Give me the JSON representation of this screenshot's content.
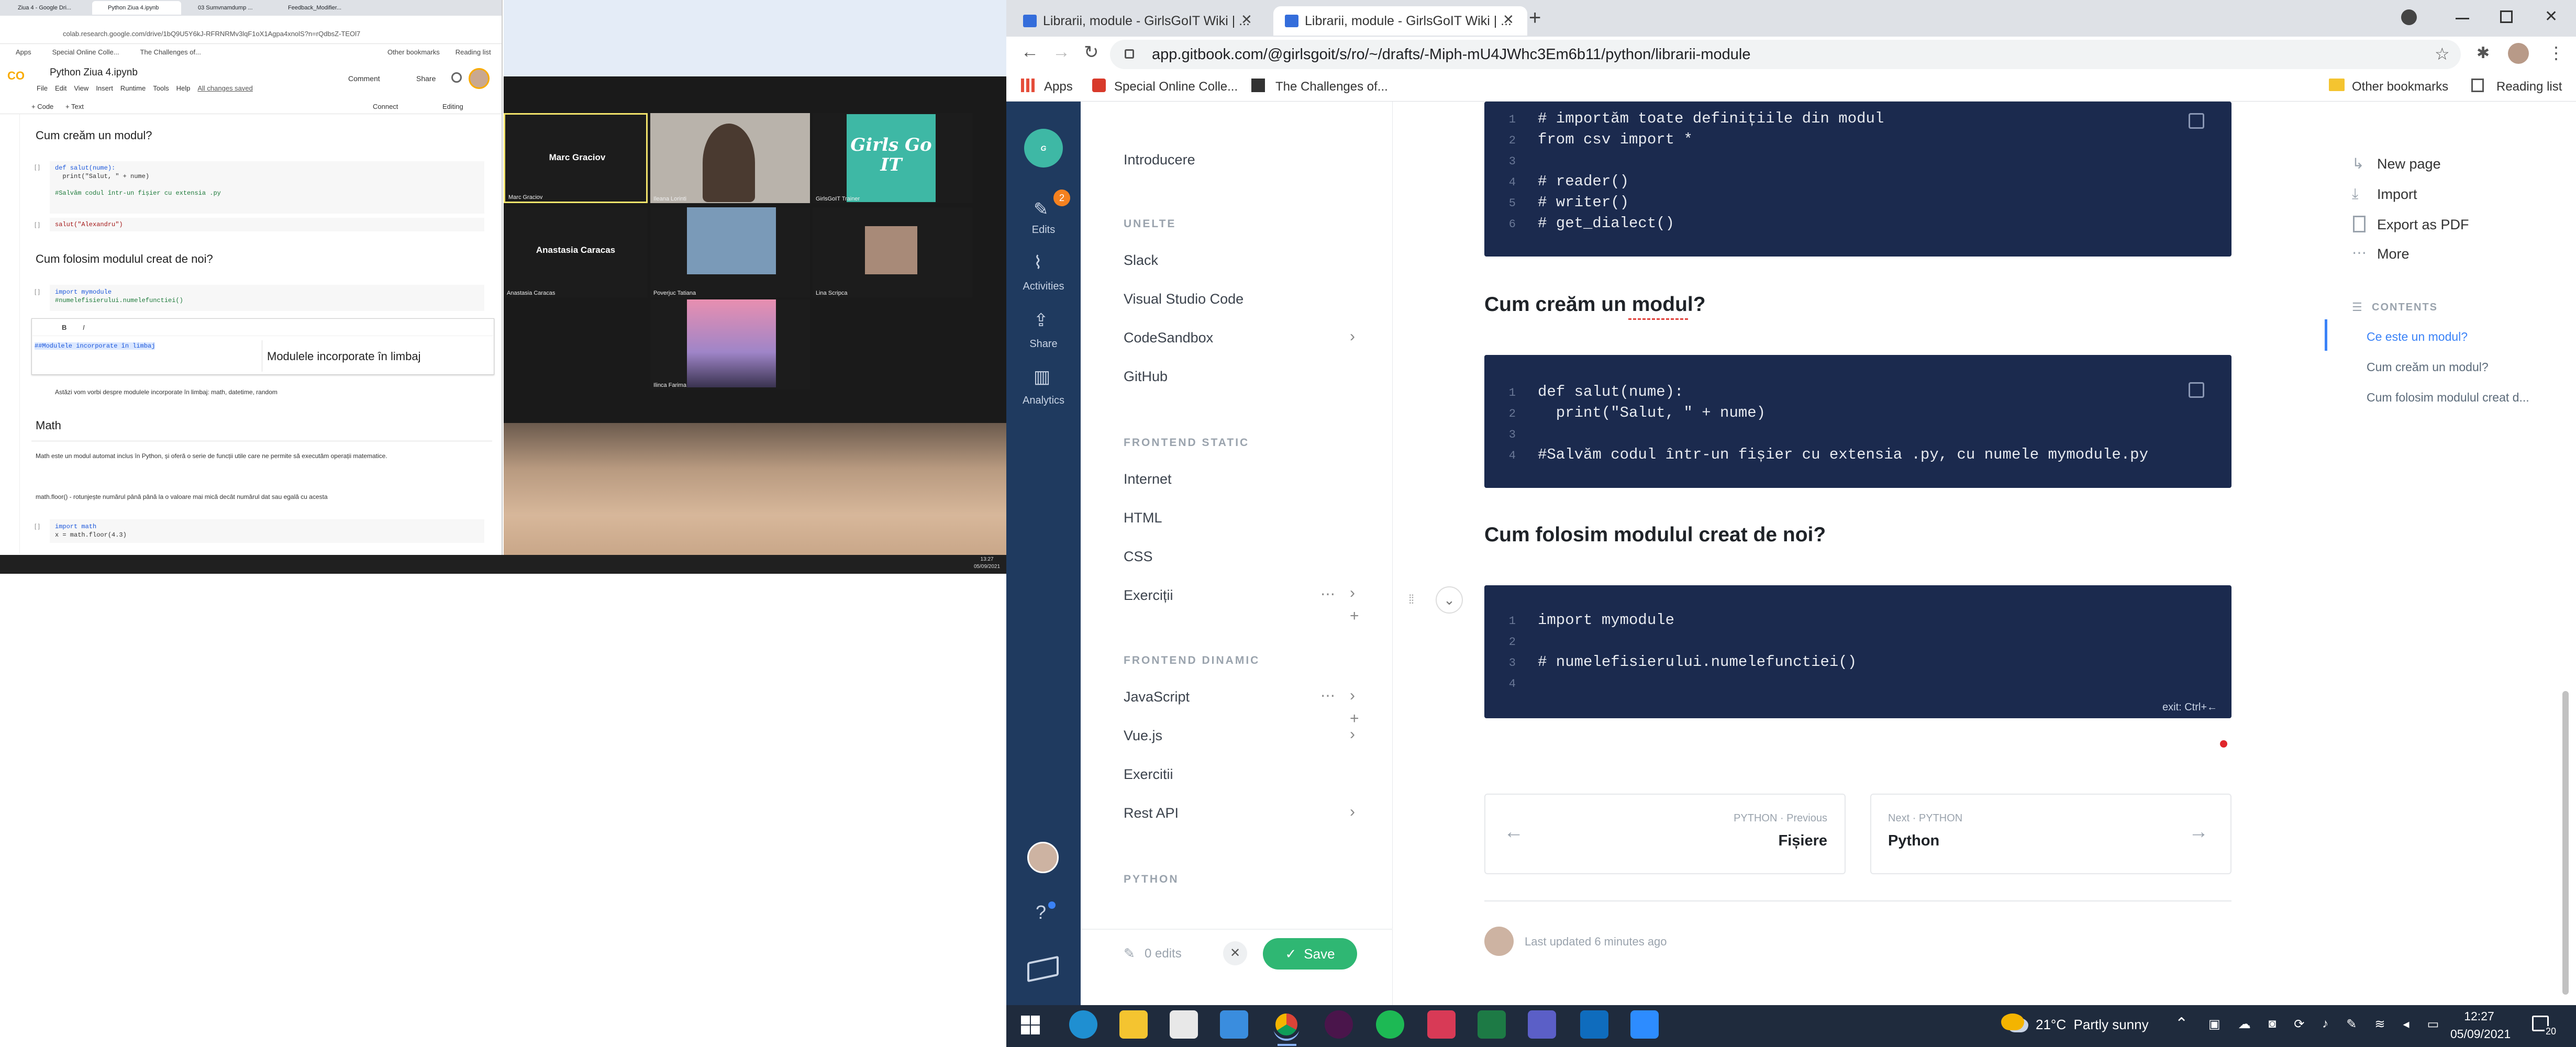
{
  "colab": {
    "tabs": [
      "Ziua 4 - Google Dri...",
      "Python Ziua 4.ipynb",
      "03 Sumvnamdump ...",
      "Feedback_Modifier..."
    ],
    "url": "colab.research.google.com/drive/1bQ9U5Y6kJ-RFRNRMv3lqF1oX1Agpa4xnolS?n=rQdbsZ-TEOl7",
    "bookmarks": [
      "Apps",
      "Special Online Colle...",
      "The Challenges of..."
    ],
    "bookmarks_right": [
      "Other bookmarks",
      "Reading list"
    ],
    "title": "Python Ziua 4.ipynb",
    "menu": [
      "File",
      "Edit",
      "View",
      "Insert",
      "Runtime",
      "Tools",
      "Help"
    ],
    "saved": "All changes saved",
    "comment": "Comment",
    "share": "Share",
    "add_code": "+ Code",
    "add_text": "+ Text",
    "connect": "Connect",
    "editing": "Editing",
    "h_create": "Cum creăm un modul?",
    "code1": [
      "def salut(nume):",
      "  print(\"Salut, \" + nume)",
      "",
      "#Salvăm codul într-un fișier cu extensia .py"
    ],
    "code2": "salut(\"Alexandru\")",
    "h_use": "Cum folosim modulul creat de noi?",
    "code3": [
      "import mymodule",
      "#numelefisierului.numelefunctiei()"
    ],
    "md_src": "##Modulele incorporate în limbaj",
    "md_preview": "Modulele incorporate în limbaj",
    "bullet": "Astăzi vom vorbi despre modulele incorporate în limbaj: math, datetime, random",
    "h_math": "Math",
    "math_text": "Math este un modul automat inclus în Python, și oferă o serie de funcții utile care ne permite să executăm operații matematice.",
    "floor_text": "math.floor() - rotunjește numărul până până la o valoare mai mică decât numărul dat sau egală cu acesta",
    "code4": [
      "import math",
      "x = math.floor(4.3)"
    ]
  },
  "zoom": {
    "tiles": [
      {
        "name": "Marc Graciov",
        "label": "Marc Graciov"
      },
      {
        "name": "",
        "label": "Ileana Lorinti"
      },
      {
        "name": "",
        "label": "GirlsGoIT Trainer",
        "logo": "Girls Go IT"
      },
      {
        "name": "Anastasia Caracas",
        "label": "Anastasia Caracas"
      },
      {
        "name": "",
        "label": "Poverjuc Tatiana"
      },
      {
        "name": "",
        "label": "Lina Scripca"
      },
      {
        "name": "",
        "label": "Ilinca Farima"
      }
    ]
  },
  "taskbar_left": {
    "time": "13:27",
    "date": "05/09/2021"
  },
  "browser": {
    "tabs": [
      {
        "label": "Librarii, module - GirlsGoIT Wiki | ..."
      },
      {
        "label": "Librarii, module - GirlsGoIT Wiki | ..."
      }
    ],
    "url": "app.gitbook.com/@girlsgoit/s/ro/~/drafts/-Miph-mU4JWhc3Em6b11/python/librarii-module",
    "bookmarks": [
      "Apps",
      "Special Online Colle...",
      "The Challenges of..."
    ],
    "other_bookmarks": "Other bookmarks",
    "reading_list": "Reading list"
  },
  "gitbook": {
    "rail": [
      {
        "label": "Edits",
        "badge": "2"
      },
      {
        "label": "Activities"
      },
      {
        "label": "Share"
      },
      {
        "label": "Analytics"
      }
    ],
    "nav_intro": "Introducere",
    "sections": [
      {
        "title": "UNELTE",
        "items": [
          "Slack",
          "Visual Studio Code",
          "CodeSandbox",
          "GitHub"
        ]
      },
      {
        "title": "FRONTEND STATIC",
        "items": [
          "Internet",
          "HTML",
          "CSS",
          "Exerciții"
        ]
      },
      {
        "title": "FRONTEND DINAMIC",
        "items": [
          "JavaScript",
          "Vue.js",
          "Exercitii",
          "Rest API"
        ]
      },
      {
        "title": "PYTHON",
        "items": []
      }
    ],
    "edits_count": "0 edits",
    "save": "Save",
    "code_top": [
      "# importăm toate definițiile din modul",
      "from csv import *",
      "",
      "# reader()",
      "# writer()",
      "# get_dialect()"
    ],
    "h_create": "Cum creăm un modul?",
    "code_mid": [
      "def salut(nume):",
      "  print(\"Salut, \" + nume)",
      "",
      "#Salvăm codul într-un fișier cu extensia .py, cu numele mymodule.py"
    ],
    "h_use": "Cum folosim modulul creat de noi?",
    "code_bot": [
      "import mymodule",
      "",
      "# numelefisierului.numelefunctiei()",
      ""
    ],
    "exit_hint": "exit: Ctrl+←",
    "prev_label": "PYTHON · Previous",
    "prev_title": "Fișiere",
    "next_label": "Next · PYTHON",
    "next_title": "Python",
    "last_updated": "Last updated 6 minutes ago",
    "actions": [
      "New page",
      "Import",
      "Export as PDF",
      "More"
    ],
    "contents_title": "CONTENTS",
    "toc": [
      "Ce este un modul?",
      "Cum creăm un modul?",
      "Cum folosim modulul creat d..."
    ]
  },
  "taskbar": {
    "weather": "21°C  Partly sunny",
    "time": "12:27",
    "date": "05/09/2021",
    "notif": "20"
  }
}
